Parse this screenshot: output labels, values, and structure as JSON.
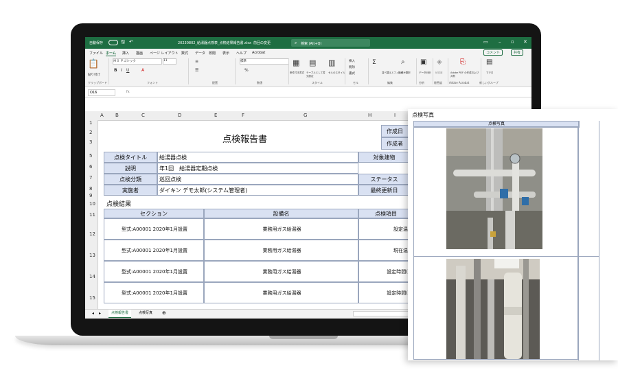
{
  "excel": {
    "title_bar": {
      "autosave": "自動保存",
      "filename": "20230802_給湯器点検表_点検結果報告書.xlsx",
      "saved_state": "前回の変更",
      "search": "検索 (Alt+Q)"
    },
    "menu": [
      "ファイル",
      "ホーム",
      "挿入",
      "描画",
      "ページ レイアウト",
      "数式",
      "データ",
      "校閲",
      "表示",
      "ヘルプ",
      "Acrobat"
    ],
    "menu_active": "ホーム",
    "comment_button": "コメント",
    "share_button": "共有",
    "ribbon": {
      "font_name": "ＭＳ Ｐゴシック",
      "font_size": "11",
      "number_format": "標準",
      "groups": [
        "クリップボード",
        "フォント",
        "配置",
        "数値",
        "スタイル",
        "セル",
        "編集",
        "分析",
        "秘密度",
        "Adobe Acrobat",
        "新しいグループ"
      ],
      "labels": [
        "貼り付け",
        "条件付き書式",
        "テーブルとして書式設定",
        "セルのスタイル",
        "挿入",
        "削除",
        "書式",
        "並べ替えとフィルター",
        "検索と選択",
        "データ分析",
        "秘密度",
        "Adobe PDF の作成および共有",
        "マクロ"
      ]
    },
    "name_box": "O16",
    "fx": "fx",
    "col_headers": [
      "A",
      "B",
      "C",
      "D",
      "E",
      "F",
      "G",
      "H",
      "I"
    ],
    "row_headers": [
      "1",
      "2",
      "3",
      "5",
      "6",
      "7",
      "8",
      "9",
      "10",
      "11",
      "12",
      "13",
      "14",
      "15"
    ],
    "sheet_tabs": [
      "点検報告書",
      "点検写真"
    ],
    "active_tab": "点検報告書"
  },
  "report": {
    "title": "点検報告書",
    "created_date_label": "作成日",
    "created_by_label": "作成者",
    "fields": [
      {
        "label": "点検タイトル",
        "value": "給湯器点検"
      },
      {
        "label": "説明",
        "value": "年1回　給湯器定期点検"
      },
      {
        "label": "点検分類",
        "value": "巡回点検"
      },
      {
        "label": "実施者",
        "value": "ダイキン デモ太郎(システム管理者)"
      }
    ],
    "right_labels": [
      "対象建物",
      "ステータス",
      "最終更新日"
    ],
    "results_heading": "点検結果",
    "results_headers": [
      "セクション",
      "設備名",
      "点検項目"
    ],
    "results_rows": [
      {
        "section": "型式:A00001 2020年1月設置",
        "equipment": "業務用ガス給湯器",
        "item": "設定温度"
      },
      {
        "section": "型式:A00001 2020年1月設置",
        "equipment": "業務用ガス給湯器",
        "item": "現在温度"
      },
      {
        "section": "型式:A00001 2020年1月設置",
        "equipment": "業務用ガス給湯器",
        "item": "設定時間(開"
      },
      {
        "section": "型式:A00001 2020年1月設置",
        "equipment": "業務用ガス給湯器",
        "item": "設定時間(終"
      }
    ]
  },
  "photo_panel": {
    "title": "点検写真",
    "column_header": "点検写真"
  },
  "colors": {
    "excel_green": "#1e6e42",
    "header_fill": "#d9e1f2",
    "border": "#9aa6bd"
  }
}
